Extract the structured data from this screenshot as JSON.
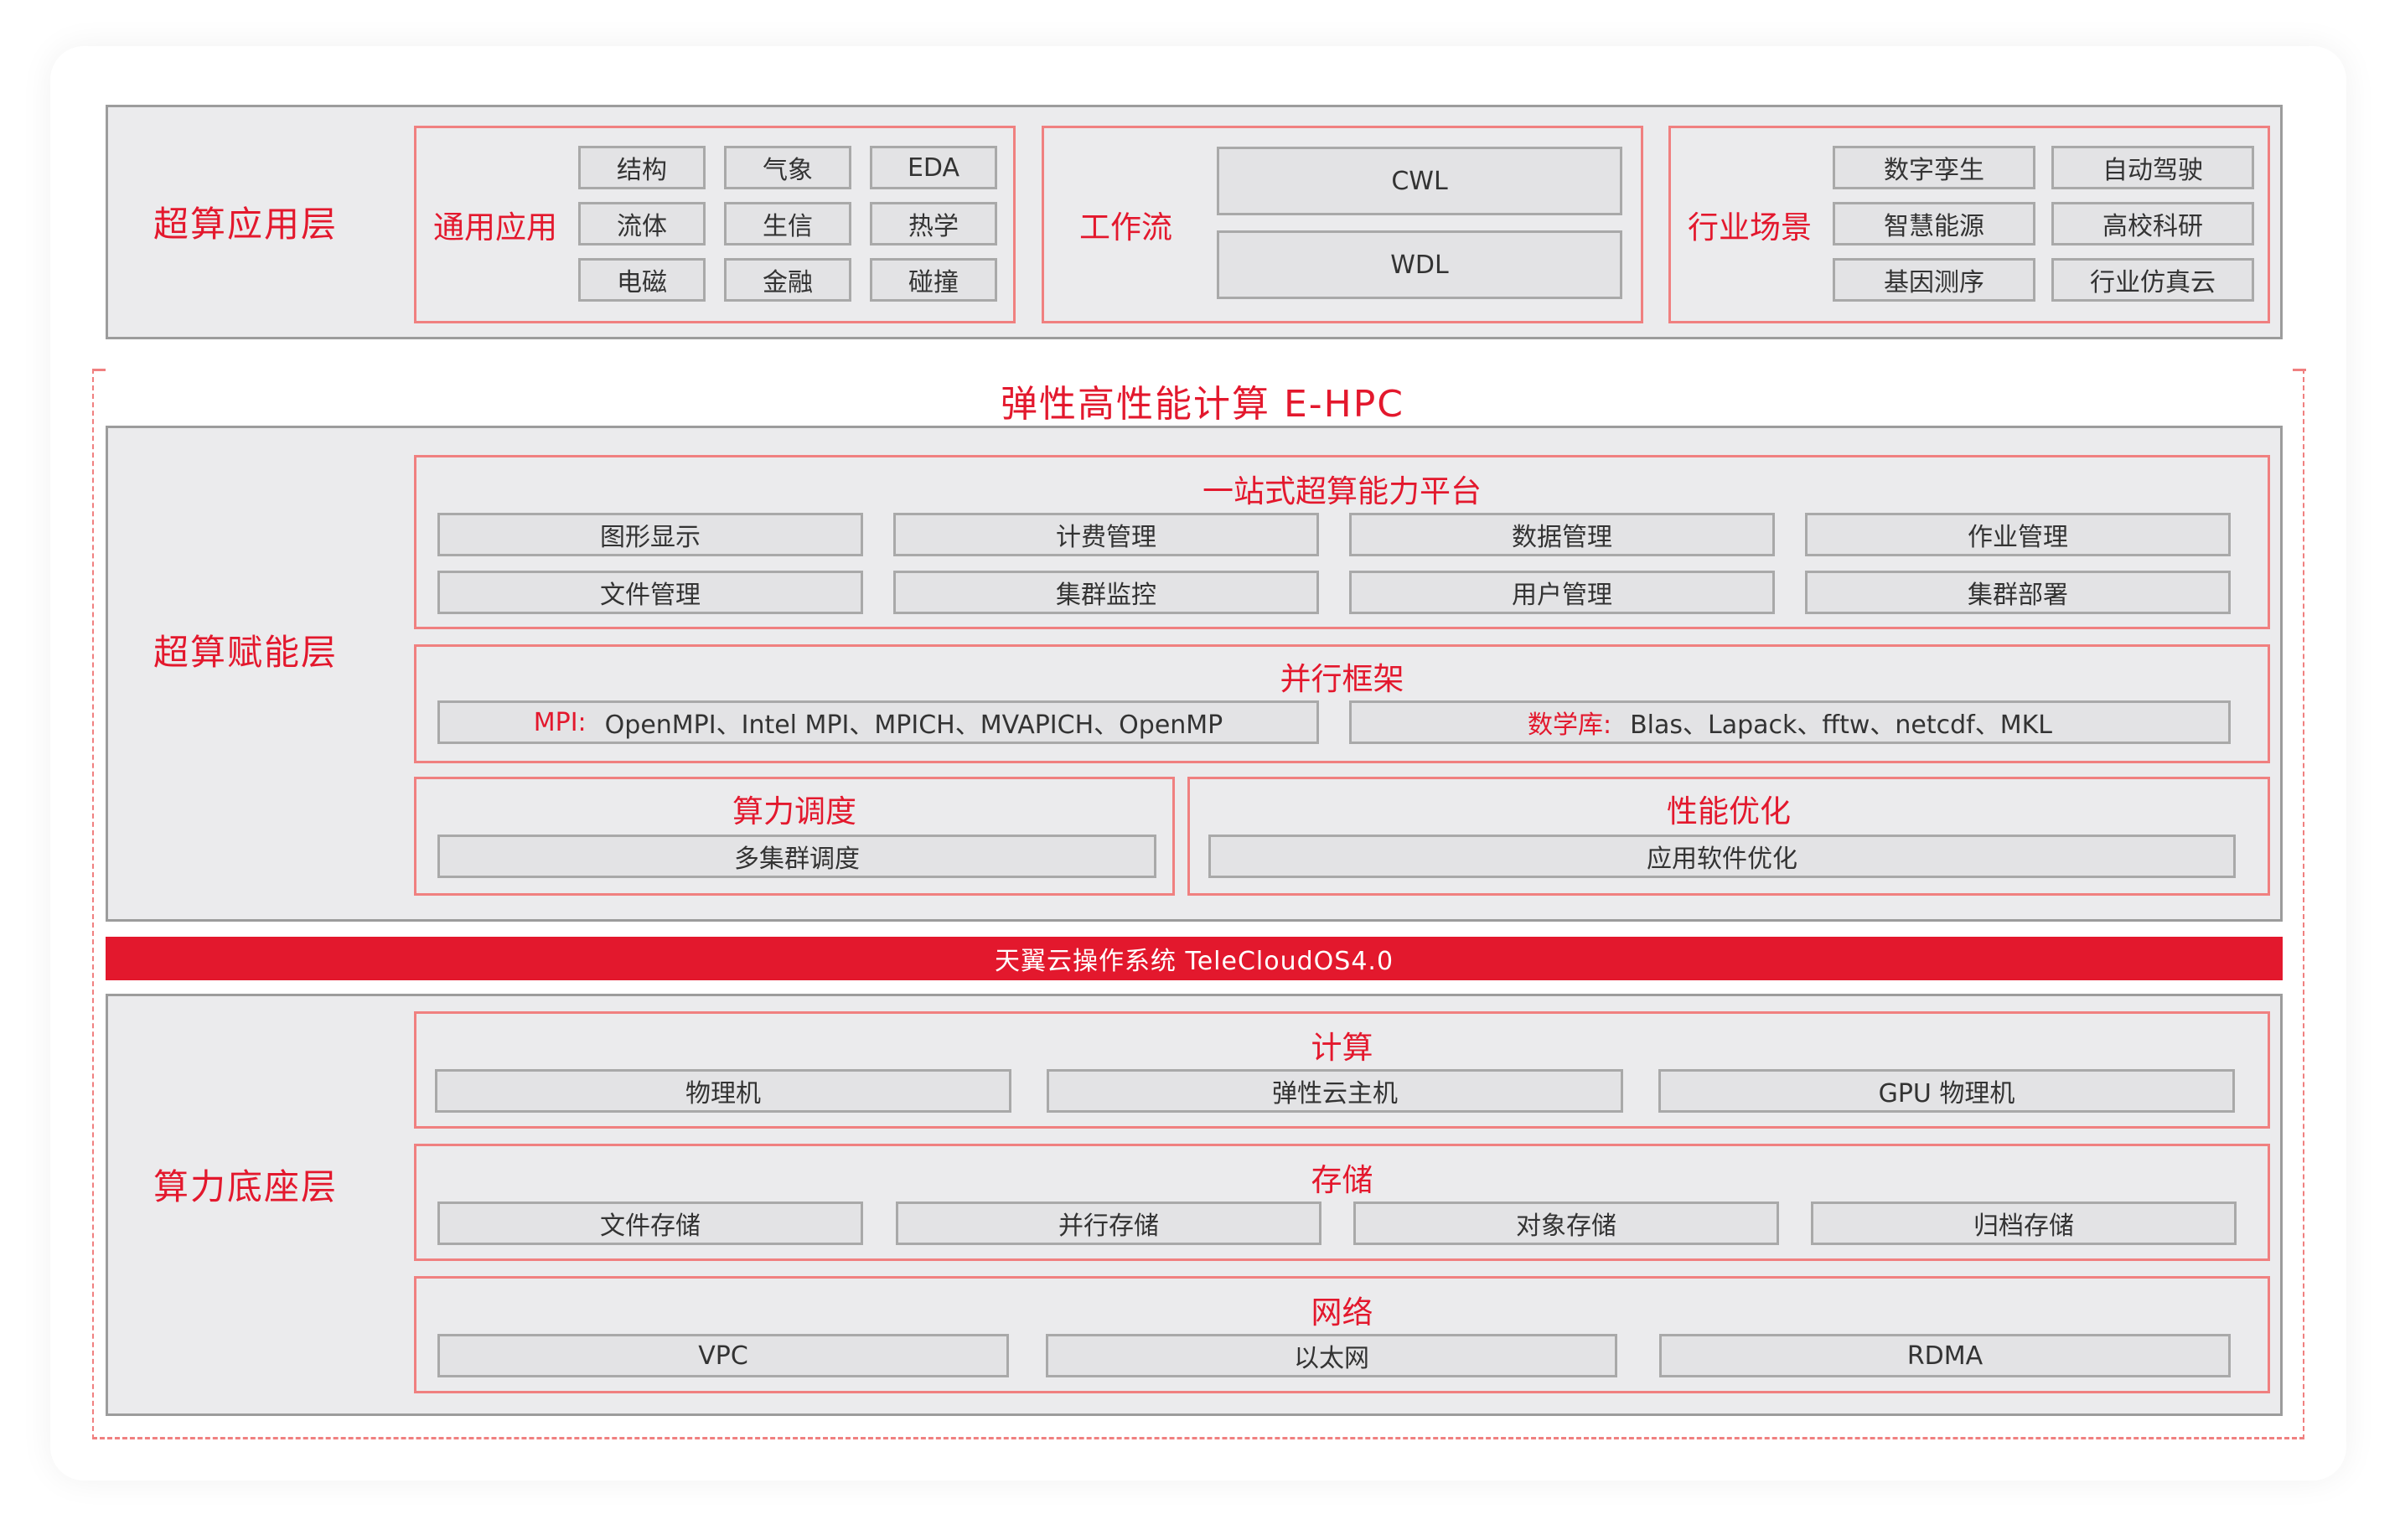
{
  "app_layer": {
    "title": "超算应用层",
    "general": {
      "label": "通用应用",
      "items": [
        "结构",
        "气象",
        "EDA",
        "流体",
        "生信",
        "热学",
        "电磁",
        "金融",
        "碰撞"
      ]
    },
    "workflow": {
      "label": "工作流",
      "items": [
        "CWL",
        "WDL"
      ]
    },
    "industry": {
      "label": "行业场景",
      "items": [
        "数字孪生",
        "自动驾驶",
        "智慧能源",
        "高校科研",
        "基因测序",
        "行业仿真云"
      ]
    }
  },
  "ehpc_title": "弹性高性能计算 E-HPC",
  "enable_layer": {
    "title": "超算赋能层",
    "platform": {
      "label": "一站式超算能力平台",
      "items": [
        "图形显示",
        "计费管理",
        "数据管理",
        "作业管理",
        "文件管理",
        "集群监控",
        "用户管理",
        "集群部署"
      ]
    },
    "parallel": {
      "label": "并行框架",
      "mpi_label": "MPI:",
      "mpi_items": "OpenMPI、Intel MPI、MPICH、MVAPICH、OpenMP",
      "math_label": "数学库:",
      "math_items": "Blas、Lapack、fftw、netcdf、MKL"
    },
    "scheduling": {
      "label": "算力调度",
      "item": "多集群调度"
    },
    "optimization": {
      "label": "性能优化",
      "item": "应用软件优化"
    }
  },
  "os_bar": "天翼云操作系统 TeleCloudOS4.0",
  "base_layer": {
    "title": "算力底座层",
    "compute": {
      "label": "计算",
      "items": [
        "物理机",
        "弹性云主机",
        "GPU 物理机"
      ]
    },
    "storage": {
      "label": "存储",
      "items": [
        "文件存储",
        "并行存储",
        "对象存储",
        "归档存储"
      ]
    },
    "network": {
      "label": "网络",
      "items": [
        "VPC",
        "以太网",
        "RDMA"
      ]
    }
  },
  "colors": {
    "accent": "#e3182d",
    "layer_bg": "#ebebed",
    "cell_bg": "#e3e3e5",
    "border_red": "#f08080"
  }
}
